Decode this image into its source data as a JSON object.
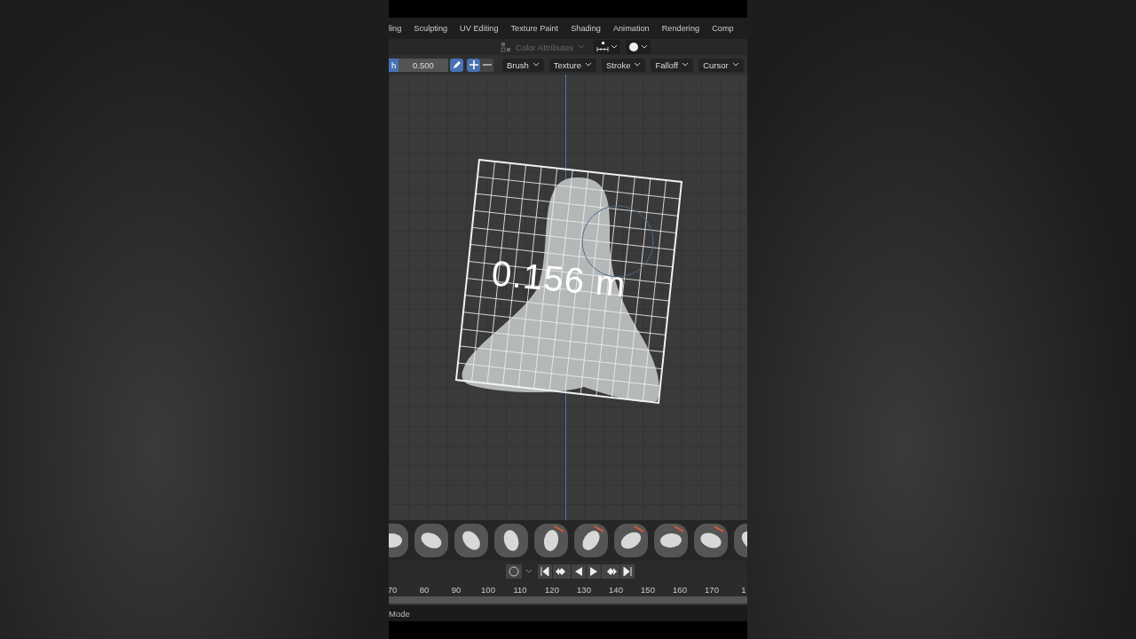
{
  "workspace_tabs": [
    "ling",
    "Sculpting",
    "UV Editing",
    "Texture Paint",
    "Shading",
    "Animation",
    "Rendering",
    "Comp"
  ],
  "header": {
    "color_attributes": {
      "label": "Color Attributes",
      "disabled": true
    }
  },
  "tool_settings": {
    "field_label": "h",
    "value": "0.500",
    "menus": [
      "Brush",
      "Texture",
      "Stroke",
      "Falloff",
      "Cursor"
    ]
  },
  "viewport": {
    "measurement": "0.156 m"
  },
  "timeline": {
    "ticks": [
      "70",
      "80",
      "90",
      "100",
      "110",
      "120",
      "130",
      "140",
      "150",
      "160",
      "170",
      "1"
    ]
  },
  "status_bar": {
    "mode": "Mode"
  }
}
